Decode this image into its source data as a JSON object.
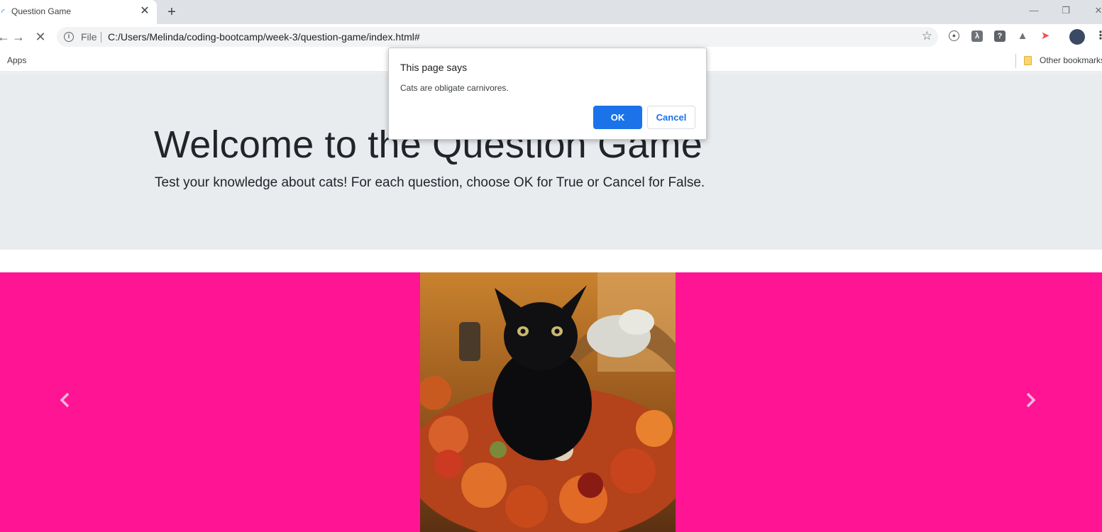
{
  "browser": {
    "tab_title": "Question Game",
    "tab_close": "✕",
    "new_tab": "+",
    "file_label": "File",
    "url": "C:/Users/Melinda/coding-bootcamp/week-3/question-game/index.html#",
    "bookmarks_apps": "Apps",
    "bookmarks_other": "Other bookmarks"
  },
  "page": {
    "title": "Welcome to the Question Game",
    "lead": "Test your knowledge about cats! For each question, choose OK for True or Cancel for False."
  },
  "dialog": {
    "title": "This page says",
    "message": "Cats are obligate carnivores.",
    "ok_label": "OK",
    "cancel_label": "Cancel"
  },
  "colors": {
    "carousel_bg": "#ff1493",
    "jumbotron_bg": "#e9ecef",
    "primary_button": "#1a73e8"
  },
  "icons": {
    "back": "arrow-left-icon",
    "forward": "arrow-right-icon",
    "stop": "close-icon",
    "info": "info-icon",
    "bookmark_star": "star-icon",
    "carousel_prev": "chevron-left-icon",
    "carousel_next": "chevron-right-icon"
  }
}
